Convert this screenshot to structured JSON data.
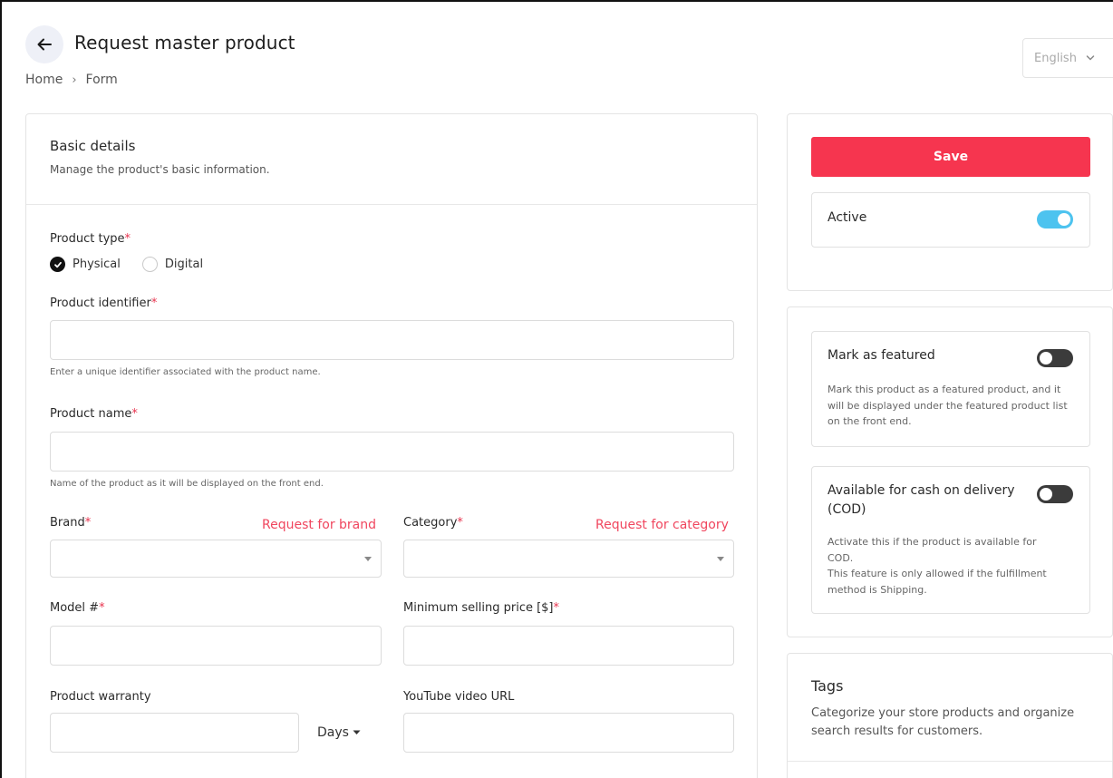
{
  "header": {
    "title": "Request master product",
    "breadcrumb": [
      "Home",
      "Form"
    ],
    "language": "English"
  },
  "basic_details": {
    "title": "Basic details",
    "subtitle": "Manage the product's basic information.",
    "product_type": {
      "label": "Product type",
      "options": [
        {
          "label": "Physical",
          "selected": true
        },
        {
          "label": "Digital",
          "selected": false
        }
      ]
    },
    "product_identifier": {
      "label": "Product identifier",
      "value": "",
      "hint": "Enter a unique identifier associated with the product name."
    },
    "product_name": {
      "label": "Product name",
      "value": "",
      "hint": "Name of the product as it will be displayed on the front end."
    },
    "brand": {
      "label": "Brand",
      "value": "",
      "request_link": "Request for brand"
    },
    "category": {
      "label": "Category",
      "value": "",
      "request_link": "Request for category"
    },
    "model": {
      "label": "Model #",
      "value": ""
    },
    "min_price": {
      "label": "Minimum selling price [$]",
      "value": ""
    },
    "warranty": {
      "label": "Product warranty",
      "value": "",
      "unit": "Days"
    },
    "youtube": {
      "label": "YouTube video URL",
      "value": ""
    },
    "required_mark": "*"
  },
  "sidebar": {
    "save_label": "Save",
    "active": {
      "label": "Active",
      "on": true
    },
    "featured": {
      "label": "Mark as featured",
      "on": false,
      "description": "Mark this product as a featured product, and it will be displayed under the featured product list on the front end."
    },
    "cod": {
      "label": "Available for cash on delivery (COD)",
      "on": false,
      "description_1": "Activate this if the product is available for COD.",
      "description_2": "This feature is only allowed if the fulfillment method is Shipping."
    },
    "tags": {
      "title": "Tags",
      "description": "Categorize your store products and organize search results for customers."
    }
  },
  "colors": {
    "accent_red": "#f6354f",
    "toggle_on": "#4dc3ef",
    "toggle_off": "#3b3b3b"
  }
}
